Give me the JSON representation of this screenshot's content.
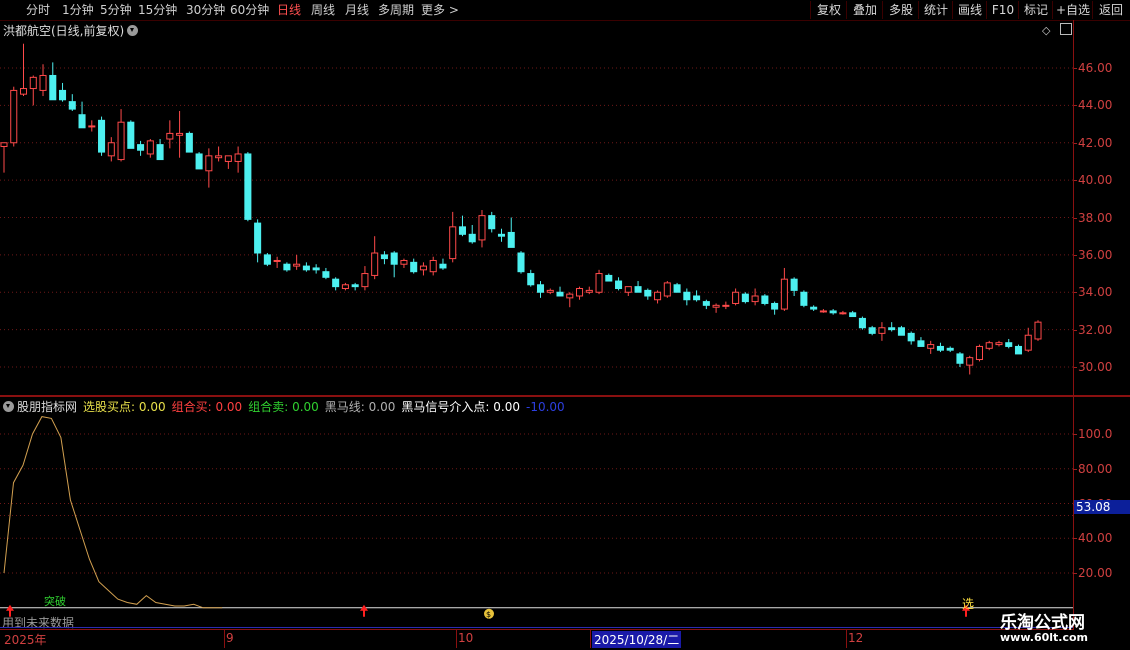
{
  "toolbar": {
    "left_tabs": [
      "分时",
      "1分钟",
      "5分钟",
      "15分钟",
      "30分钟",
      "60分钟",
      "日线",
      "周线",
      "月线",
      "多周期",
      "更多 >"
    ],
    "active_tab": "日线",
    "right_buttons": [
      "复权",
      "叠加",
      "多股",
      "统计",
      "画线",
      "F10",
      "标记",
      "+自选",
      "返回"
    ]
  },
  "main_panel": {
    "title": "洪都航空(日线,前复权)",
    "y_ticks": [
      "46.00",
      "44.00",
      "42.00",
      "40.00",
      "38.00",
      "36.00",
      "34.00",
      "32.00",
      "30.00"
    ]
  },
  "indicator_panel": {
    "name": "股朋指标网",
    "items": [
      {
        "label": "选股买点:",
        "value": "0.00",
        "color": "#e8e04a"
      },
      {
        "label": "组合买:",
        "value": "0.00",
        "color": "#ff4040"
      },
      {
        "label": "组合卖:",
        "value": "0.00",
        "color": "#30d030"
      },
      {
        "label": "黑马线:",
        "value": "0.00",
        "color": "#b0b0b0"
      },
      {
        "label": "黑马信号介入点:",
        "value": "0.00",
        "color": "#ffffff"
      },
      {
        "label": "",
        "value": "-10.00",
        "color": "#2c3fe0"
      }
    ],
    "y_ticks": [
      "100.0",
      "80.00",
      "60.00",
      "40.00",
      "20.00"
    ],
    "current_value": "53.08",
    "signal_labels": {
      "breakout": "突破",
      "select": "选"
    },
    "future_label": "用到未来数据"
  },
  "date_axis": {
    "labels": [
      "2025年",
      "9",
      "10",
      "2025/10/28/二",
      "12"
    ],
    "selected": "2025/10/28/二"
  },
  "watermark": {
    "line1": "乐淘公式网",
    "line2": "www.60lt.com"
  },
  "colors": {
    "up": "#ff4a4a",
    "down": "#4df0f0",
    "grid": "#6e1818",
    "indicator_line": "#d2a050"
  },
  "chart_data": {
    "type": "candlestick",
    "y_range": [
      29.5,
      47.5
    ],
    "candles": [
      [
        41.8,
        42.0,
        40.4,
        42.0
      ],
      [
        42.0,
        45.0,
        41.8,
        44.8
      ],
      [
        44.6,
        47.3,
        44.5,
        44.9
      ],
      [
        44.9,
        45.6,
        44.0,
        45.5
      ],
      [
        44.8,
        46.2,
        44.5,
        45.6
      ],
      [
        45.6,
        46.3,
        44.3,
        44.3
      ],
      [
        44.8,
        45.2,
        44.2,
        44.3
      ],
      [
        44.2,
        44.6,
        43.7,
        43.8
      ],
      [
        43.5,
        44.2,
        42.8,
        42.8
      ],
      [
        42.9,
        43.2,
        42.6,
        42.9
      ],
      [
        43.2,
        43.4,
        41.3,
        41.5
      ],
      [
        41.3,
        42.3,
        41.0,
        42.0
      ],
      [
        41.1,
        43.8,
        41.0,
        43.1
      ],
      [
        43.1,
        43.2,
        41.7,
        41.7
      ],
      [
        41.9,
        42.1,
        41.3,
        41.6
      ],
      [
        41.4,
        42.2,
        41.2,
        42.1
      ],
      [
        41.9,
        42.2,
        41.1,
        41.1
      ],
      [
        42.2,
        43.2,
        41.7,
        42.5
      ],
      [
        42.4,
        43.7,
        41.2,
        42.5
      ],
      [
        42.5,
        42.6,
        41.5,
        41.5
      ],
      [
        41.4,
        41.5,
        40.6,
        40.6
      ],
      [
        40.5,
        41.7,
        39.6,
        41.3
      ],
      [
        41.2,
        41.8,
        41.0,
        41.3
      ],
      [
        41.0,
        41.3,
        40.6,
        41.3
      ],
      [
        41.0,
        41.8,
        40.4,
        41.4
      ],
      [
        41.4,
        41.5,
        37.8,
        37.9
      ],
      [
        37.7,
        37.9,
        35.6,
        36.1
      ],
      [
        36.0,
        36.1,
        35.4,
        35.5
      ],
      [
        35.7,
        35.9,
        35.3,
        35.7
      ],
      [
        35.5,
        35.6,
        35.1,
        35.2
      ],
      [
        35.4,
        36.0,
        35.2,
        35.5
      ],
      [
        35.4,
        35.6,
        35.1,
        35.2
      ],
      [
        35.3,
        35.5,
        35.0,
        35.2
      ],
      [
        35.1,
        35.3,
        34.7,
        34.8
      ],
      [
        34.7,
        34.8,
        34.1,
        34.3
      ],
      [
        34.2,
        34.5,
        34.1,
        34.4
      ],
      [
        34.4,
        34.5,
        34.1,
        34.3
      ],
      [
        34.3,
        35.4,
        34.1,
        35.0
      ],
      [
        34.9,
        37.0,
        34.7,
        36.1
      ],
      [
        36.0,
        36.2,
        35.5,
        35.8
      ],
      [
        36.1,
        36.2,
        34.8,
        35.5
      ],
      [
        35.5,
        35.8,
        35.3,
        35.7
      ],
      [
        35.6,
        35.8,
        35.0,
        35.1
      ],
      [
        35.2,
        35.6,
        34.9,
        35.4
      ],
      [
        35.1,
        35.9,
        34.9,
        35.7
      ],
      [
        35.5,
        35.8,
        35.2,
        35.3
      ],
      [
        35.8,
        38.3,
        35.6,
        37.5
      ],
      [
        37.5,
        38.1,
        37.0,
        37.1
      ],
      [
        37.1,
        37.6,
        36.6,
        36.7
      ],
      [
        36.8,
        38.4,
        36.4,
        38.1
      ],
      [
        38.1,
        38.3,
        37.2,
        37.4
      ],
      [
        37.1,
        37.4,
        36.7,
        37.0
      ],
      [
        37.2,
        38.0,
        36.6,
        36.4
      ],
      [
        36.1,
        36.2,
        35.0,
        35.1
      ],
      [
        35.0,
        35.2,
        34.3,
        34.4
      ],
      [
        34.4,
        34.6,
        33.7,
        34.0
      ],
      [
        34.0,
        34.2,
        33.9,
        34.1
      ],
      [
        34.0,
        34.3,
        33.8,
        33.8
      ],
      [
        33.7,
        34.0,
        33.2,
        33.9
      ],
      [
        33.8,
        34.3,
        33.6,
        34.2
      ],
      [
        34.0,
        34.3,
        33.9,
        34.1
      ],
      [
        34.0,
        35.2,
        33.9,
        35.0
      ],
      [
        34.9,
        35.0,
        34.6,
        34.6
      ],
      [
        34.6,
        34.8,
        34.1,
        34.2
      ],
      [
        34.0,
        34.3,
        33.8,
        34.3
      ],
      [
        34.3,
        34.6,
        34.0,
        34.0
      ],
      [
        34.1,
        34.2,
        33.6,
        33.8
      ],
      [
        33.6,
        34.1,
        33.4,
        34.0
      ],
      [
        33.8,
        34.6,
        33.7,
        34.5
      ],
      [
        34.4,
        34.5,
        34.0,
        34.0
      ],
      [
        34.0,
        34.2,
        33.3,
        33.6
      ],
      [
        33.8,
        34.1,
        33.5,
        33.6
      ],
      [
        33.5,
        33.6,
        33.1,
        33.3
      ],
      [
        33.2,
        33.4,
        32.9,
        33.3
      ],
      [
        33.3,
        33.5,
        33.1,
        33.3
      ],
      [
        33.4,
        34.2,
        33.3,
        34.0
      ],
      [
        33.9,
        34.0,
        33.4,
        33.5
      ],
      [
        33.5,
        34.2,
        33.3,
        33.8
      ],
      [
        33.8,
        33.9,
        33.3,
        33.4
      ],
      [
        33.4,
        33.5,
        32.8,
        33.1
      ],
      [
        33.1,
        35.3,
        33.0,
        34.7
      ],
      [
        34.7,
        34.8,
        33.8,
        34.1
      ],
      [
        34.0,
        34.1,
        33.2,
        33.3
      ],
      [
        33.2,
        33.3,
        33.0,
        33.1
      ],
      [
        33.0,
        33.1,
        32.9,
        33.0
      ],
      [
        33.0,
        33.1,
        32.8,
        32.9
      ],
      [
        32.9,
        33.0,
        32.8,
        32.9
      ],
      [
        32.9,
        33.0,
        32.7,
        32.7
      ],
      [
        32.6,
        32.7,
        32.0,
        32.1
      ],
      [
        32.1,
        32.2,
        31.7,
        31.8
      ],
      [
        31.8,
        32.4,
        31.4,
        32.1
      ],
      [
        32.1,
        32.4,
        31.9,
        32.0
      ],
      [
        32.1,
        32.2,
        31.7,
        31.7
      ],
      [
        31.8,
        31.9,
        31.2,
        31.4
      ],
      [
        31.4,
        31.6,
        31.1,
        31.1
      ],
      [
        31.0,
        31.4,
        30.7,
        31.2
      ],
      [
        31.1,
        31.3,
        30.8,
        30.9
      ],
      [
        31.0,
        31.1,
        30.8,
        30.9
      ],
      [
        30.7,
        30.8,
        30.0,
        30.2
      ],
      [
        30.1,
        30.6,
        29.6,
        30.5
      ],
      [
        30.4,
        31.2,
        30.3,
        31.1
      ],
      [
        31.0,
        31.4,
        30.9,
        31.3
      ],
      [
        31.2,
        31.4,
        31.1,
        31.3
      ],
      [
        31.3,
        31.5,
        31.0,
        31.1
      ],
      [
        31.1,
        31.2,
        30.7,
        30.7
      ],
      [
        30.9,
        32.1,
        30.8,
        31.7
      ],
      [
        31.5,
        32.5,
        31.4,
        32.4
      ]
    ],
    "indicator": {
      "y_range": [
        0,
        120
      ],
      "line": [
        20,
        72,
        82,
        100,
        110,
        109,
        98,
        62,
        45,
        28,
        15,
        10,
        5,
        3,
        2,
        7,
        3,
        2,
        1,
        1,
        2,
        0,
        0,
        0,
        0,
        0,
        0,
        0,
        0,
        0,
        0,
        0,
        0,
        0,
        0,
        0,
        0,
        0,
        0,
        0,
        0,
        0,
        0,
        0,
        0,
        0,
        0,
        0,
        0,
        0,
        0,
        0,
        0,
        0,
        0,
        0,
        0,
        0,
        0,
        0,
        0,
        0,
        0,
        0,
        0,
        0,
        0,
        0,
        0,
        0,
        0,
        0,
        0,
        0,
        0,
        0,
        0,
        0,
        0,
        0,
        0,
        0,
        0,
        0,
        0,
        0,
        0,
        0,
        0,
        0,
        0,
        0,
        0,
        0,
        0,
        0,
        0,
        0,
        0,
        0,
        0,
        0,
        0,
        0,
        0,
        0,
        0,
        0,
        0,
        0
      ]
    }
  }
}
